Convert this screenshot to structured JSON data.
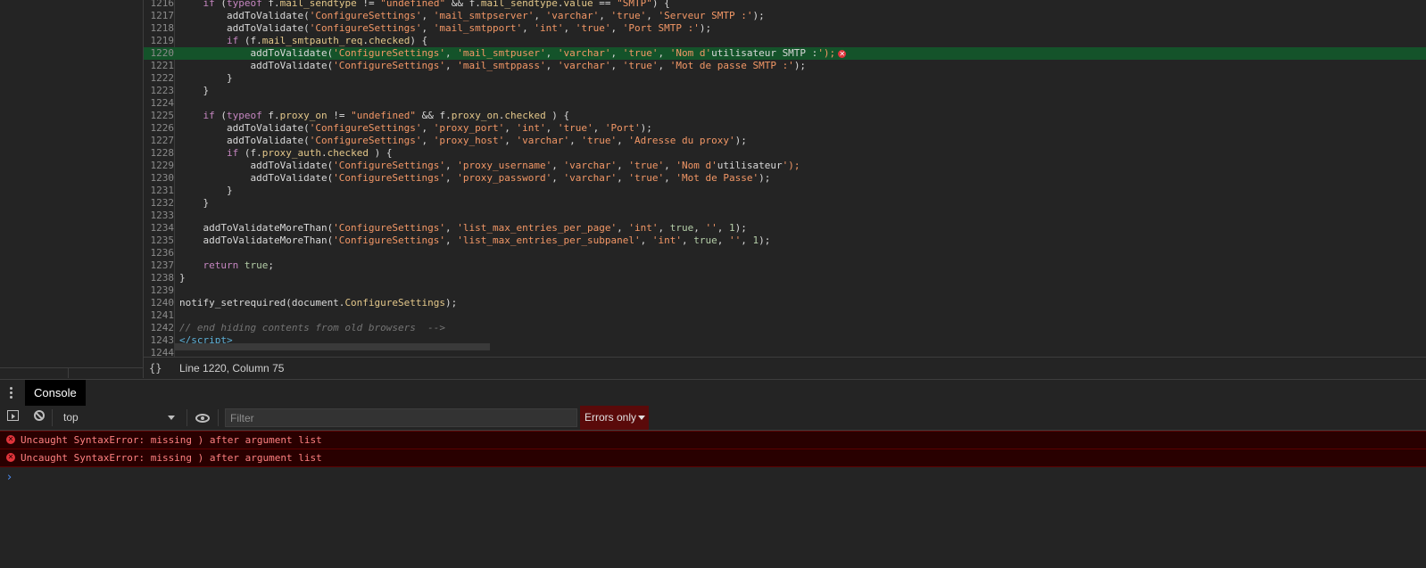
{
  "editor": {
    "active_line": "1220",
    "lines": [
      {
        "num": "1216",
        "html": "    <span class='kw'>if</span> (<span class='kw'>typeof</span> f.<span class='prop'>mail_sendtype</span> != <span class='str'>\"undefined\"</span> &amp;&amp; f.<span class='prop'>mail_sendtype</span>.<span class='prop'>value</span> == <span class='str'>\"SMTP\"</span>) {"
      },
      {
        "num": "1217",
        "html": "        addToValidate(<span class='str'>'ConfigureSettings'</span>, <span class='str'>'mail_smtpserver'</span>, <span class='str'>'varchar'</span>, <span class='str'>'true'</span>, <span class='str'>'Serveur SMTP :'</span>);"
      },
      {
        "num": "1218",
        "html": "        addToValidate(<span class='str'>'ConfigureSettings'</span>, <span class='str'>'mail_smtpport'</span>, <span class='str'>'int'</span>, <span class='str'>'true'</span>, <span class='str'>'Port SMTP :'</span>);"
      },
      {
        "num": "1219",
        "html": "        <span class='kw'>if</span> (f.<span class='prop'>mail_smtpauth_req</span>.<span class='prop'>checked</span>) {"
      },
      {
        "num": "1220",
        "html": "            addToValidate(<span class='str'>'ConfigureSettings'</span>, <span class='str'>'mail_smtpuser'</span>, <span class='str'>'varchar'</span>, <span class='str'>'true'</span>, <span class='str'>'Nom d'</span>utilisateur SMTP :<span class='str'>');</span>",
        "active": true
      },
      {
        "num": "1221",
        "html": "            addToValidate(<span class='str'>'ConfigureSettings'</span>, <span class='str'>'mail_smtppass'</span>, <span class='str'>'varchar'</span>, <span class='str'>'true'</span>, <span class='str'>'Mot de passe SMTP :'</span>);"
      },
      {
        "num": "1222",
        "html": "        }"
      },
      {
        "num": "1223",
        "html": "    }"
      },
      {
        "num": "1224",
        "html": ""
      },
      {
        "num": "1225",
        "html": "    <span class='kw'>if</span> (<span class='kw'>typeof</span> f.<span class='prop'>proxy_on</span> != <span class='str'>\"undefined\"</span> &amp;&amp; f.<span class='prop'>proxy_on</span>.<span class='prop'>checked</span> ) {"
      },
      {
        "num": "1226",
        "html": "        addToValidate(<span class='str'>'ConfigureSettings'</span>, <span class='str'>'proxy_port'</span>, <span class='str'>'int'</span>, <span class='str'>'true'</span>, <span class='str'>'Port'</span>);"
      },
      {
        "num": "1227",
        "html": "        addToValidate(<span class='str'>'ConfigureSettings'</span>, <span class='str'>'proxy_host'</span>, <span class='str'>'varchar'</span>, <span class='str'>'true'</span>, <span class='str'>'Adresse du proxy'</span>);"
      },
      {
        "num": "1228",
        "html": "        <span class='kw'>if</span> (f.<span class='prop'>proxy_auth</span>.<span class='prop'>checked</span> ) {"
      },
      {
        "num": "1229",
        "html": "            addToValidate(<span class='str'>'ConfigureSettings'</span>, <span class='str'>'proxy_username'</span>, <span class='str'>'varchar'</span>, <span class='str'>'true'</span>, <span class='str'>'Nom d'</span>utilisateur<span class='str'>');</span>"
      },
      {
        "num": "1230",
        "html": "            addToValidate(<span class='str'>'ConfigureSettings'</span>, <span class='str'>'proxy_password'</span>, <span class='str'>'varchar'</span>, <span class='str'>'true'</span>, <span class='str'>'Mot de Passe'</span>);"
      },
      {
        "num": "1231",
        "html": "        }"
      },
      {
        "num": "1232",
        "html": "    }"
      },
      {
        "num": "1233",
        "html": ""
      },
      {
        "num": "1234",
        "html": "    addToValidateMoreThan(<span class='str'>'ConfigureSettings'</span>, <span class='str'>'list_max_entries_per_page'</span>, <span class='str'>'int'</span>, <span class='boolv'>true</span>, <span class='str'>''</span>, <span class='num'>1</span>);"
      },
      {
        "num": "1235",
        "html": "    addToValidateMoreThan(<span class='str'>'ConfigureSettings'</span>, <span class='str'>'list_max_entries_per_subpanel'</span>, <span class='str'>'int'</span>, <span class='boolv'>true</span>, <span class='str'>''</span>, <span class='num'>1</span>);"
      },
      {
        "num": "1236",
        "html": ""
      },
      {
        "num": "1237",
        "html": "    <span class='kw'>return</span> <span class='boolv'>true</span>;"
      },
      {
        "num": "1238",
        "html": "}"
      },
      {
        "num": "1239",
        "html": ""
      },
      {
        "num": "1240",
        "html": "notify_setrequired(document.<span class='prop'>ConfigureSettings</span>);"
      },
      {
        "num": "1241",
        "html": ""
      },
      {
        "num": "1242",
        "html": "<span class='comment'>// end hiding contents from old browsers  --&gt;</span>"
      },
      {
        "num": "1243",
        "html": "<span class='tag'>&lt;/script&gt;</span>"
      },
      {
        "num": "1244",
        "html": ""
      }
    ],
    "error_marker_glyph": "✕"
  },
  "status": {
    "brace_glyph": "{}",
    "cursor_position": "Line 1220, Column 75"
  },
  "drawer": {
    "tab_console": "Console"
  },
  "toolbar": {
    "context": "top",
    "filter_placeholder": "Filter",
    "level": "Errors only"
  },
  "console": {
    "messages": [
      {
        "icon": "error-icon",
        "text": "Uncaught SyntaxError: missing ) after argument list"
      },
      {
        "icon": "error-icon",
        "text": "Uncaught SyntaxError: missing ) after argument list"
      }
    ],
    "prompt_glyph": "›"
  },
  "colors": {
    "active_line_bg": "#14532a",
    "error_bg": "#290000",
    "error_text": "#fe8080",
    "prompt": "#4d8ff5"
  }
}
